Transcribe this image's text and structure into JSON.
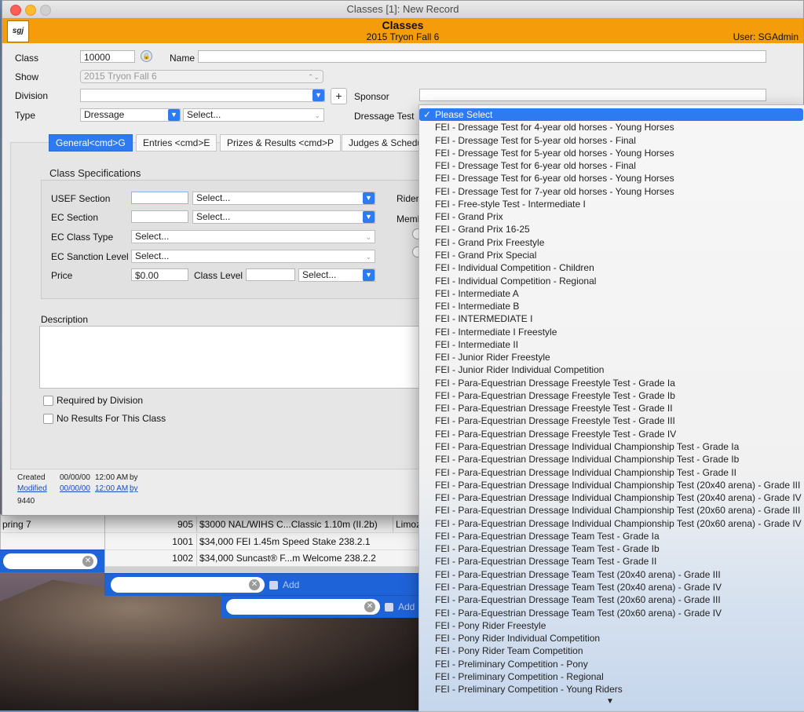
{
  "window": {
    "title": "Classes [1]: New Record"
  },
  "header": {
    "title": "Classes",
    "subtitle": "2015 Tryon Fall 6",
    "user": "User: SGAdmin",
    "logo_text": "sgj"
  },
  "form": {
    "class_label": "Class",
    "class_value": "10000",
    "name_label": "Name",
    "name_value": "",
    "show_label": "Show",
    "show_value": "2015 Tryon Fall 6",
    "division_label": "Division",
    "division_value": "",
    "add_button": "+",
    "sponsor_label": "Sponsor",
    "sponsor_value": "",
    "type_label": "Type",
    "type_value": "Dressage",
    "type_subselect": "Select...",
    "dressage_test_label": "Dressage Test"
  },
  "tabs": [
    "General<cmd>G",
    "Entries <cmd>E",
    "Prizes & Results <cmd>P",
    "Judges & Schedu"
  ],
  "specs": {
    "heading": "Class Specifications",
    "usef_section_label": "USEF Section",
    "usef_section_value": "",
    "usef_select": "Select...",
    "ec_section_label": "EC Section",
    "ec_section_value": "",
    "ec_select": "Select...",
    "ec_class_type_label": "EC Class Type",
    "ec_class_type_value": "Select...",
    "ec_sanction_label": "EC Sanction Level",
    "ec_sanction_value": "Select...",
    "price_label": "Price",
    "price_value": "$0.00",
    "class_level_label": "Class Level",
    "class_level_value": "",
    "class_level_select": "Select...",
    "rider_label": "Rider",
    "member_label": "Memb"
  },
  "description": {
    "label": "Description",
    "value": ""
  },
  "checkboxes": {
    "required": "Required by Division",
    "no_results": "No Results For This Class"
  },
  "footer": {
    "created_label": "Created",
    "created_date": "00/00/00",
    "created_time": "12:00 AM",
    "created_by": "by",
    "modified_label": "Modified",
    "modified_date": "00/00/00",
    "modified_time": "12:00 AM",
    "modified_by": "by",
    "record_id": "9440"
  },
  "background_list": {
    "rows": [
      {
        "left": "pring 7",
        "num": "905",
        "text": "$3000 NAL/WIHS C...Classic 1.10m (II.2b)",
        "extra": "Limoz"
      },
      {
        "left": "",
        "num": "1001",
        "text": "$34,000 FEI 1.45m Speed Stake 238.2.1",
        "extra": ""
      },
      {
        "left": "",
        "num": "1002",
        "text": "$34,000 Suncast® F...m Welcome 238.2.2",
        "extra": ""
      }
    ],
    "add_label": "Add"
  },
  "dropdown": {
    "selected": "Please Select",
    "items": [
      "FEI - Dressage Test for 4-year old horses - Young Horses",
      "FEI - Dressage Test for 5-year old horses - Final",
      "FEI - Dressage Test for 5-year old horses - Young Horses",
      "FEI - Dressage Test for 6-year old horses - Final",
      "FEI - Dressage Test for 6-year old horses - Young Horses",
      "FEI - Dressage Test for 7-year old horses - Young Horses",
      "FEI - Free-style Test - Intermediate I",
      "FEI - Grand Prix",
      "FEI - Grand Prix 16-25",
      "FEI - Grand Prix Freestyle",
      "FEI - Grand Prix Special",
      "FEI - Individual Competition - Children",
      "FEI - Individual Competition - Regional",
      "FEI - Intermediate A",
      "FEI - Intermediate B",
      "FEI - INTERMEDIATE I",
      "FEI - Intermediate I Freestyle",
      "FEI - Intermediate II",
      "FEI - Junior Rider Freestyle",
      "FEI - Junior Rider Individual Competition",
      "FEI - Para-Equestrian Dressage Freestyle Test - Grade Ia",
      "FEI - Para-Equestrian Dressage Freestyle Test - Grade Ib",
      "FEI - Para-Equestrian Dressage Freestyle Test - Grade II",
      "FEI - Para-Equestrian Dressage Freestyle Test - Grade III",
      "FEI - Para-Equestrian Dressage Freestyle Test - Grade IV",
      "FEI - Para-Equestrian Dressage Individual Championship Test - Grade Ia",
      "FEI - Para-Equestrian Dressage Individual Championship Test - Grade Ib",
      "FEI - Para-Equestrian Dressage Individual Championship Test - Grade II",
      "FEI - Para-Equestrian Dressage Individual Championship Test (20x40 arena) - Grade III",
      "FEI - Para-Equestrian Dressage Individual Championship Test (20x40 arena) - Grade IV",
      "FEI - Para-Equestrian Dressage Individual Championship Test (20x60 arena) - Grade III",
      "FEI - Para-Equestrian Dressage Individual Championship Test (20x60 arena) - Grade IV",
      "FEI - Para-Equestrian Dressage Team Test - Grade Ia",
      "FEI - Para-Equestrian Dressage Team Test - Grade Ib",
      "FEI - Para-Equestrian Dressage Team Test - Grade II",
      "FEI - Para-Equestrian Dressage Team Test (20x40 arena) - Grade III",
      "FEI - Para-Equestrian Dressage Team Test (20x40 arena) - Grade IV",
      "FEI - Para-Equestrian Dressage Team Test (20x60 arena) - Grade III",
      "FEI - Para-Equestrian Dressage Team Test (20x60 arena) - Grade IV",
      "FEI - Pony Rider Freestyle",
      "FEI - Pony Rider Individual Competition",
      "FEI - Pony Rider Team Competition",
      "FEI - Preliminary Competition - Pony",
      "FEI - Preliminary Competition - Regional",
      "FEI - Preliminary Competition - Young Riders"
    ]
  },
  "colors": {
    "accent": "#2e7af0",
    "header": "#f59c0b",
    "selection_bar": "#1f63d8"
  }
}
